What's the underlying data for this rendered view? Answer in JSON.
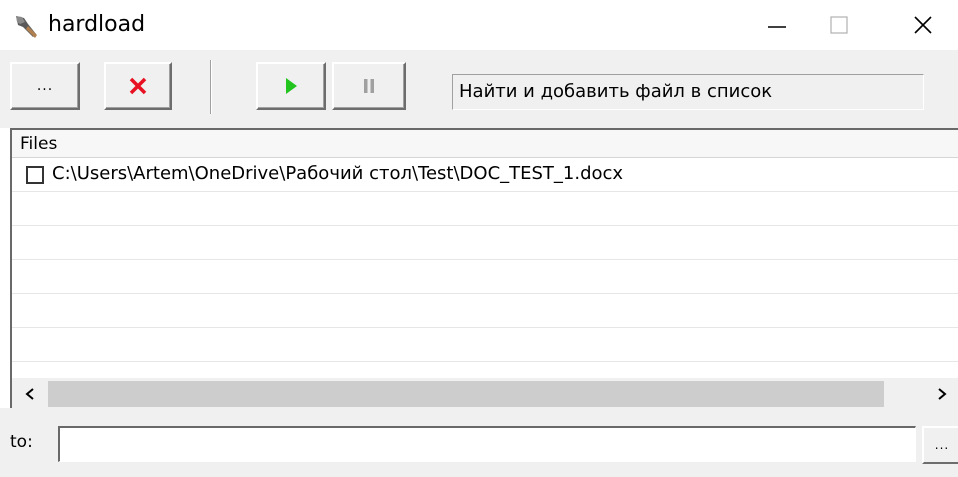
{
  "window": {
    "title": "hardload",
    "app_icon": "shovel-icon",
    "controls": [
      "minimize-icon",
      "maximize-icon",
      "close-icon"
    ]
  },
  "toolbar": {
    "browse_label": "...",
    "remove_icon": "red-x-icon",
    "start_icon": "play-icon",
    "pause_icon": "pause-icon",
    "status_text": "Найти и добавить файл в список"
  },
  "file_list": {
    "column_header": "Files",
    "rows": [
      {
        "checked": false,
        "path": "C:\\Users\\Artem\\OneDrive\\Рабочий стол\\Test\\DOC_TEST_1.docx"
      }
    ]
  },
  "target": {
    "label": "to:",
    "value": "",
    "browse_label": "..."
  },
  "colors": {
    "remove_red": "#e81123",
    "play_green": "#22c41e",
    "pause_gray": "#a0a0a0",
    "window_bg": "#f0f0f0"
  }
}
